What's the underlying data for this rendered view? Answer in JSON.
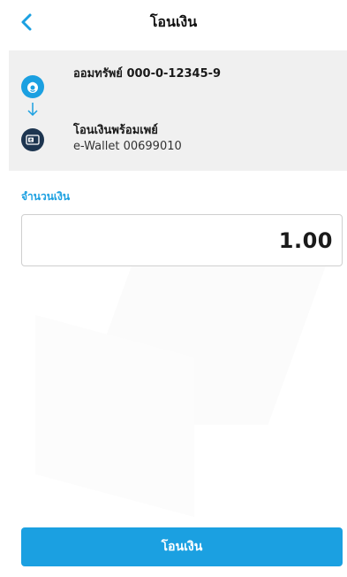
{
  "header": {
    "title": "โอนเงิน",
    "back_icon": "chevron-left-icon"
  },
  "transfer": {
    "from": {
      "icon": "bank-logo-icon",
      "label": "ออมทรัพย์ 000-0-12345-9"
    },
    "arrow_icon": "arrow-down-icon",
    "to": {
      "icon": "e-wallet-icon",
      "label": "โอนเงินพร้อมเพย์",
      "detail": "e-Wallet 00699010"
    }
  },
  "amount": {
    "label": "จำนวนเงิน",
    "value": "1.00"
  },
  "submit": {
    "label": "โอนเงิน"
  },
  "colors": {
    "accent": "#1ba0e1",
    "wallet_icon_bg": "#1d3550",
    "section_bg": "#f0f0f0"
  }
}
